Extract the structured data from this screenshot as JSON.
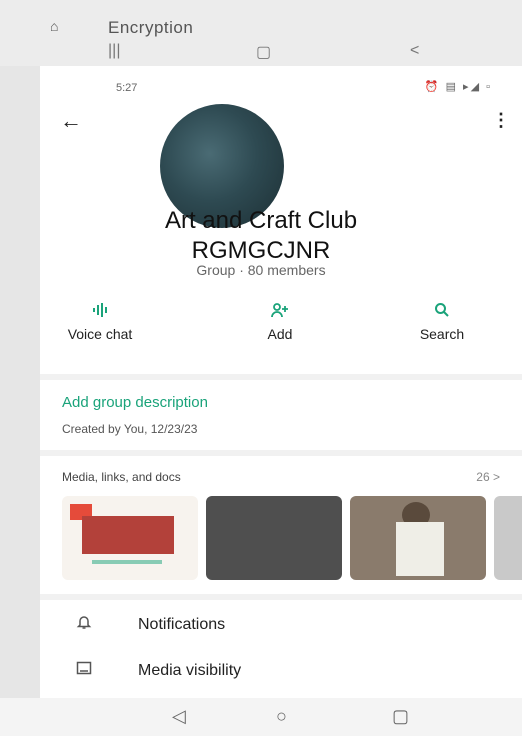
{
  "background": {
    "behind_title": "Encryption",
    "recent_nav": {
      "menu": "|||",
      "home": "▢",
      "back": "<"
    }
  },
  "status": {
    "time": "5:27",
    "icons": "⏰ ▤ ▸◢ ▫"
  },
  "header": {
    "back": "←",
    "more": "⋮"
  },
  "group": {
    "name_line1": "Art and Craft Club",
    "name_line2": "RGMGCJNR",
    "meta": "Group · 80 members"
  },
  "actions": [
    {
      "label": "Voice chat",
      "icon": "voice-chat-icon"
    },
    {
      "label": "Add",
      "icon": "add-person-icon"
    },
    {
      "label": "Search",
      "icon": "search-icon"
    }
  ],
  "description": {
    "add_label": "Add group description",
    "created": "Created by You, 12/23/23"
  },
  "media": {
    "header": "Media, links, and docs",
    "count": "26 >"
  },
  "settings": [
    {
      "label": "Notifications",
      "icon": "bell-icon"
    },
    {
      "label": "Media visibility",
      "icon": "image-icon"
    }
  ],
  "navbar": {
    "back": "◁",
    "home": "○",
    "recents": "▢"
  },
  "colors": {
    "accent": "#1aa37a"
  }
}
